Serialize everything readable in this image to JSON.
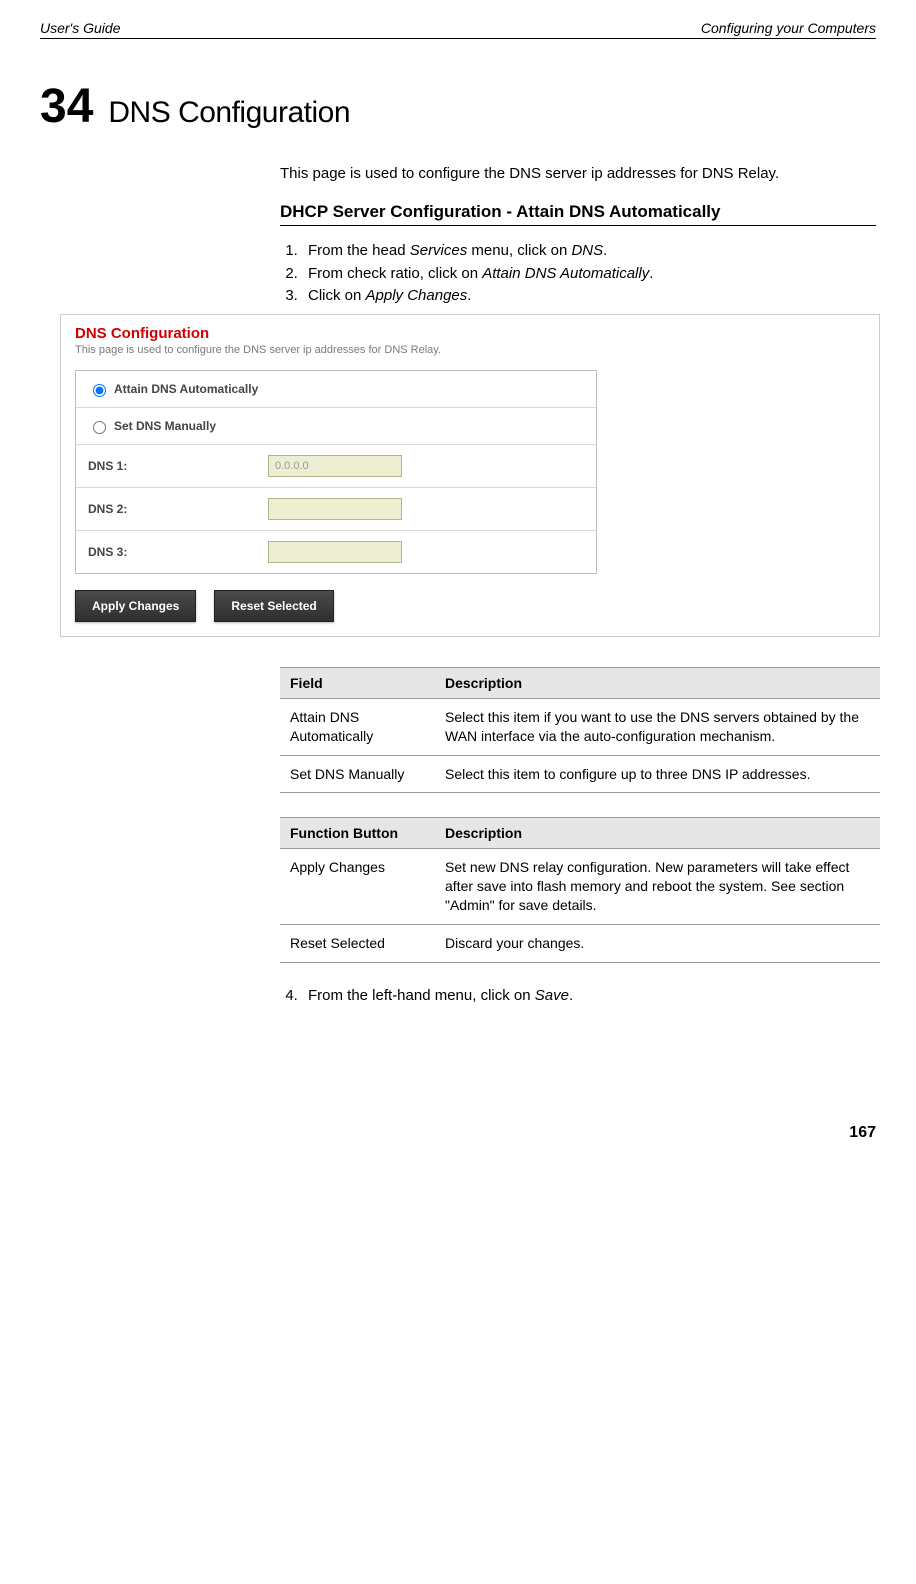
{
  "header": {
    "left": "User's Guide",
    "right": "Configuring your Computers"
  },
  "chapter": {
    "number": "34",
    "title": "DNS Configuration"
  },
  "intro": "This page is used to configure the DNS server ip addresses for DNS Relay.",
  "section_heading": "DHCP Server Configuration - Attain DNS Automatically",
  "steps": {
    "s1_a": "From the head ",
    "s1_i1": "Services",
    "s1_b": " menu, click on ",
    "s1_i2": "DNS",
    "s1_c": ".",
    "s2_a": "From check ratio, click on ",
    "s2_i": "Attain DNS Automatically",
    "s2_b": ".",
    "s3_a": "Click on ",
    "s3_i": "Apply Changes",
    "s3_b": "."
  },
  "screenshot": {
    "title": "DNS Configuration",
    "subtitle": "This page is used to configure the DNS server ip addresses for DNS Relay.",
    "opt_auto": "Attain DNS Automatically",
    "opt_manual": "Set DNS Manually",
    "dns1_label": "DNS 1:",
    "dns1_value": "0.0.0.0",
    "dns2_label": "DNS 2:",
    "dns3_label": "DNS 3:",
    "btn_apply": "Apply Changes",
    "btn_reset": "Reset Selected"
  },
  "table1": {
    "h1": "Field",
    "h2": "Description",
    "rows": [
      {
        "f": "Attain DNS Automatically",
        "d": "Select this item if you want to use the DNS servers obtained by the WAN interface via the auto-configuration mechanism."
      },
      {
        "f": "Set DNS Manually",
        "d": "Select this item to configure up to three DNS IP addresses."
      }
    ]
  },
  "table2": {
    "h1": "Function Button",
    "h2": "Description",
    "rows": [
      {
        "f": "Apply Changes",
        "d": "Set new DNS relay configuration. New parameters will take effect after save into flash memory and reboot the system. See section \"Admin\" for save details."
      },
      {
        "f": "Reset Selected",
        "d": "Discard your changes."
      }
    ]
  },
  "step4": {
    "a": "From the left-hand menu, click on ",
    "i": "Save",
    "b": "."
  },
  "page_number": "167"
}
